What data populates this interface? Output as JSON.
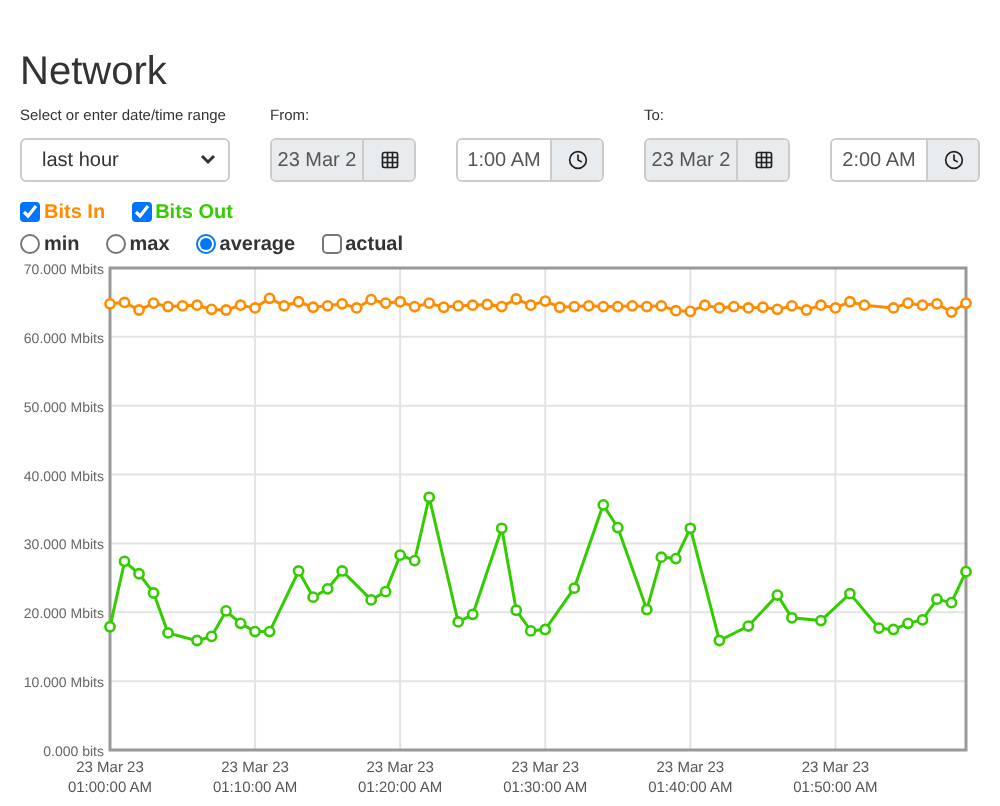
{
  "title": "Network",
  "range": {
    "label": "Select or enter date/time range",
    "value": "last hour"
  },
  "from": {
    "label": "From:",
    "date": "23 Mar 2",
    "time": "1:00 AM"
  },
  "to": {
    "label": "To:",
    "date": "23 Mar 2",
    "time": "2:00 AM"
  },
  "series_toggles": [
    {
      "checked": true
    },
    {
      "checked": true
    }
  ],
  "modes": [
    {
      "label": "min",
      "kind": "radio",
      "selected": false
    },
    {
      "label": "max",
      "kind": "radio",
      "selected": false
    },
    {
      "label": "average",
      "kind": "radio",
      "selected": true
    },
    {
      "label": "actual",
      "kind": "checkbox",
      "selected": false
    }
  ],
  "chart": {
    "chart_data": {
      "type": "line",
      "categories": [
        "23 Mar 23\n01:00:00 AM",
        null,
        null,
        null,
        null,
        null,
        null,
        null,
        null,
        null,
        "23 Mar 23\n01:10:00 AM",
        null,
        null,
        null,
        null,
        null,
        null,
        null,
        null,
        null,
        "23 Mar 23\n01:20:00 AM",
        null,
        null,
        null,
        null,
        null,
        null,
        null,
        null,
        null,
        "23 Mar 23\n01:30:00 AM",
        null,
        null,
        null,
        null,
        null,
        null,
        null,
        null,
        null,
        "23 Mar 23\n01:40:00 AM",
        null,
        null,
        null,
        null,
        null,
        null,
        null,
        null,
        null,
        "23 Mar 23\n01:50:00 AM",
        null,
        null,
        null,
        null,
        null,
        null,
        null,
        null,
        null
      ],
      "series": [
        {
          "name": "Bits In",
          "color": "#ff8c00",
          "marker": "circle",
          "values": [
            64.8,
            65.0,
            63.9,
            64.9,
            64.4,
            64.5,
            64.6,
            64.0,
            63.9,
            64.6,
            64.2,
            65.6,
            64.5,
            65.1,
            64.3,
            64.5,
            64.8,
            64.2,
            65.4,
            64.9,
            65.1,
            64.4,
            64.9,
            64.3,
            64.5,
            64.6,
            64.7,
            64.4,
            65.5,
            64.6,
            65.2,
            64.3,
            64.4,
            64.5,
            64.4,
            64.4,
            64.5,
            64.4,
            64.5,
            63.8,
            63.7,
            64.6,
            64.2,
            64.4,
            64.2,
            64.3,
            64.0,
            64.5,
            63.9,
            64.6,
            64.2,
            65.1,
            64.6,
            null,
            64.2,
            64.9,
            64.6,
            64.8,
            63.6,
            64.9
          ]
        },
        {
          "name": "Bits Out",
          "color": "#33cc00",
          "marker": "circle",
          "values": [
            17.9,
            27.4,
            25.6,
            22.8,
            17.0,
            null,
            15.9,
            16.5,
            20.2,
            18.4,
            17.2,
            17.2,
            null,
            26.0,
            22.2,
            23.4,
            26.0,
            null,
            21.8,
            23.0,
            28.3,
            27.5,
            36.7,
            null,
            18.6,
            19.7,
            null,
            32.2,
            20.3,
            17.3,
            17.5,
            null,
            23.5,
            null,
            35.6,
            32.3,
            null,
            20.4,
            28.0,
            27.8,
            32.2,
            null,
            15.9,
            null,
            18.0,
            null,
            22.5,
            19.2,
            null,
            18.8,
            null,
            22.7,
            null,
            17.7,
            17.5,
            18.4,
            18.9,
            21.9,
            21.4,
            25.9
          ]
        }
      ],
      "grid": true,
      "ylim": [
        0,
        70
      ],
      "yticks": [
        {
          "value": 0,
          "label": "0.000 bits"
        },
        {
          "value": 10,
          "label": "10.000 Mbits"
        },
        {
          "value": 20,
          "label": "20.000 Mbits"
        },
        {
          "value": 30,
          "label": "30.000 Mbits"
        },
        {
          "value": 40,
          "label": "40.000 Mbits"
        },
        {
          "value": 50,
          "label": "50.000 Mbits"
        },
        {
          "value": 60,
          "label": "60.000 Mbits"
        },
        {
          "value": 70,
          "label": "70.000 Mbits"
        }
      ]
    }
  }
}
